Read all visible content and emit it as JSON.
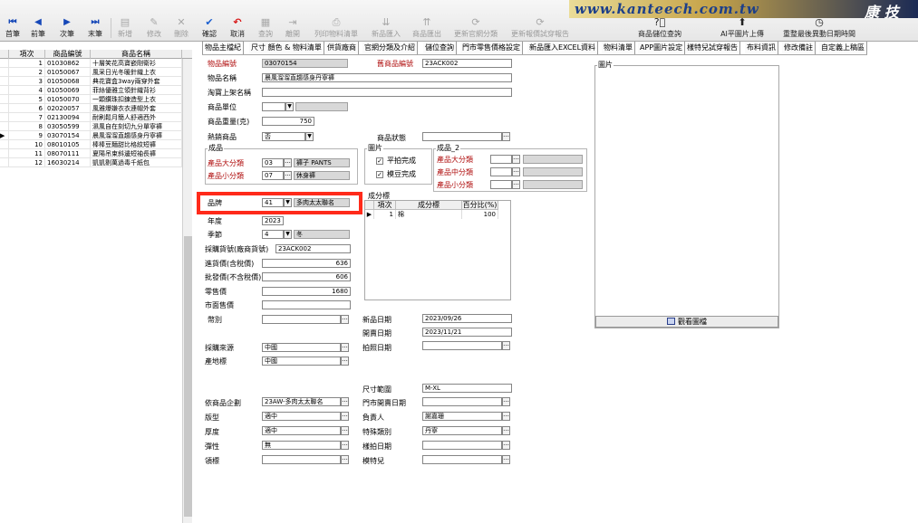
{
  "toolbar": {
    "buttons": [
      {
        "icon": "first-record-icon",
        "label": "首筆"
      },
      {
        "icon": "prev-record-icon",
        "label": "前筆"
      },
      {
        "icon": "next-record-icon",
        "label": "次筆"
      },
      {
        "icon": "last-record-icon",
        "label": "末筆"
      },
      {
        "icon": "new-icon",
        "label": "新增"
      },
      {
        "icon": "edit-icon",
        "label": "修改"
      },
      {
        "icon": "delete-icon",
        "label": "刪除"
      },
      {
        "icon": "confirm-check-icon",
        "label": "確認"
      },
      {
        "icon": "cancel-icon",
        "label": "取消"
      },
      {
        "icon": "query-icon",
        "label": "查詢"
      },
      {
        "icon": "exit-icon",
        "label": "離開"
      },
      {
        "icon": "print-icon",
        "label": "列印物料清單"
      },
      {
        "icon": "import-icon",
        "label": "新品匯入"
      },
      {
        "icon": "export-icon",
        "label": "商品匯出"
      },
      {
        "icon": "update-icon",
        "label": "更新官網分類"
      },
      {
        "icon": "update-report-icon",
        "label": "更新報價試穿報告"
      },
      {
        "icon": "location-query-icon",
        "label": "商品儲位查詢"
      },
      {
        "icon": "ai-image-upload-icon",
        "label": "AI平圖片上傳"
      },
      {
        "icon": "clock-icon",
        "label": "重整最後異動日期時間"
      }
    ],
    "banner_url": "www.kanteech.com.tw",
    "banner_brand": "康 技"
  },
  "grid": {
    "headers": [
      "項次",
      "商品編號",
      "商品名稱"
    ],
    "rows": [
      {
        "no": "1",
        "code": "01030862",
        "name": "十層笑花高寶嵌剛衛衫"
      },
      {
        "no": "2",
        "code": "01050067",
        "name": "風采日光冬暖針織上衣"
      },
      {
        "no": "3",
        "code": "01050068",
        "name": "典花寶盒3way兩穿外套"
      },
      {
        "no": "4",
        "code": "01050069",
        "name": "菲絲優雅立領針織背衫"
      },
      {
        "no": "5",
        "code": "01050070",
        "name": "一顆鑽珠扣鍊造型上衣"
      },
      {
        "no": "6",
        "code": "02020057",
        "name": "風雅爆嫌衣衣連帽外套"
      },
      {
        "no": "7",
        "code": "02130094",
        "name": "耐刷鬆月簡人舒適西外"
      },
      {
        "no": "8",
        "code": "03050599",
        "name": "濕風自在刻切九分單寧褲"
      },
      {
        "no": "9",
        "code": "03070154",
        "name": "晨風溜溜直趨感身丹寧褲"
      },
      {
        "no": "10",
        "code": "08010105",
        "name": "棒棒豆麵甜比格紋短褲"
      },
      {
        "no": "11",
        "code": "08070111",
        "name": "夏陽吊束斜邊短袖長褲"
      },
      {
        "no": "12",
        "code": "16030214",
        "name": "凱凱剔萬過毒千紙包"
      }
    ],
    "current_row_marker": "▶"
  },
  "tabs": [
    "物品主檔紀",
    "尺寸 顏色 & 物料清單",
    "供貨廠商",
    "官網分類及介紹",
    "儲位查詢",
    "門市零售價格設定",
    "新品匯入EXCEL資料",
    "物料清單",
    "APP圖片設定",
    "樣特兒試穿報告",
    "布料資訊",
    "修改備註",
    "自定義上稿區"
  ],
  "form": {
    "item_code_label": "物品編號",
    "item_code": "03070154",
    "old_code_label": "舊商品編號",
    "old_code": "23ACK002",
    "item_name_label": "物品名稱",
    "item_name": "晨風溜溜直趨感身丹寧褲",
    "shelf_name_label": "淘寶上架名稱",
    "shelf_name": "",
    "unit_label": "商品單位",
    "unit": "",
    "weight_label": "商品重量(克)",
    "weight": "750",
    "hot_label": "熱銷商品",
    "hot": "否",
    "status_label": "商品狀態",
    "status": "",
    "category_group": "成品",
    "major_label": "產品大分類",
    "major_code": "03",
    "major_name": "褲子 PANTS",
    "minor_label": "產品小分類",
    "minor_code": "07",
    "minor_name": "休身褲",
    "image_group": "圖片",
    "flat_done": "平拍完成",
    "model_done": "模豆完成",
    "category2_group": "成品_2",
    "cat2_major_label": "產品大分類",
    "cat2_mid_label": "產品中分類",
    "cat2_minor_label": "產品小分類",
    "brand_label": "品牌",
    "brand_code": "41",
    "brand_name": "多肉太太聯名",
    "year_label": "年度",
    "year": "2023",
    "season_label": "季節",
    "season_code": "4",
    "season_name": "冬",
    "purchase_label": "採購貨號(廠商貨號)",
    "purchase": "23ACK002",
    "cost_label": "進貨價(含稅價)",
    "cost": "636",
    "wholesale_label": "批發價(不含稅價)",
    "wholesale": "606",
    "retail_label": "零售價",
    "retail": "1680",
    "market_label": "市面售價",
    "market": "",
    "chest_label": "幣別",
    "chest": "",
    "source_label": "採購來源",
    "source": "中國",
    "origin_label": "產地標",
    "origin": "中國",
    "new_date_label": "新品日期",
    "new_date": "2023/09/26",
    "sale_date_label": "開賣日期",
    "sale_date": "2023/11/21",
    "photo_date_label": "拍照日期",
    "photo_date": "",
    "size_range_label": "尺寸範圍",
    "size_range": "M-XL",
    "planner_label": "依商品企劃",
    "planner": "23AW-多肉太太聯名",
    "store_date_label": "門市開賣日期",
    "store_date": "",
    "fit_label": "版型",
    "fit": "適中",
    "owner_label": "負責人",
    "owner": "謝嘉珊",
    "thickness_label": "厚度",
    "thickness": "適中",
    "special_label": "特殊類別",
    "special": "丹寧",
    "elastic_label": "彈性",
    "elastic": "無",
    "flat2_label": "樣拍日期",
    "flat2": "",
    "collar_label": "領標",
    "collar": "",
    "model_label": "模特兒",
    "model": ""
  },
  "composition": {
    "title": "成分標",
    "headers": [
      "項次",
      "成分標",
      "百分比(%)"
    ],
    "rows": [
      {
        "no": "1",
        "material": "棉",
        "pct": "100"
      }
    ]
  },
  "image_panel": {
    "title": "圖片",
    "button": "觀看圖檔"
  }
}
